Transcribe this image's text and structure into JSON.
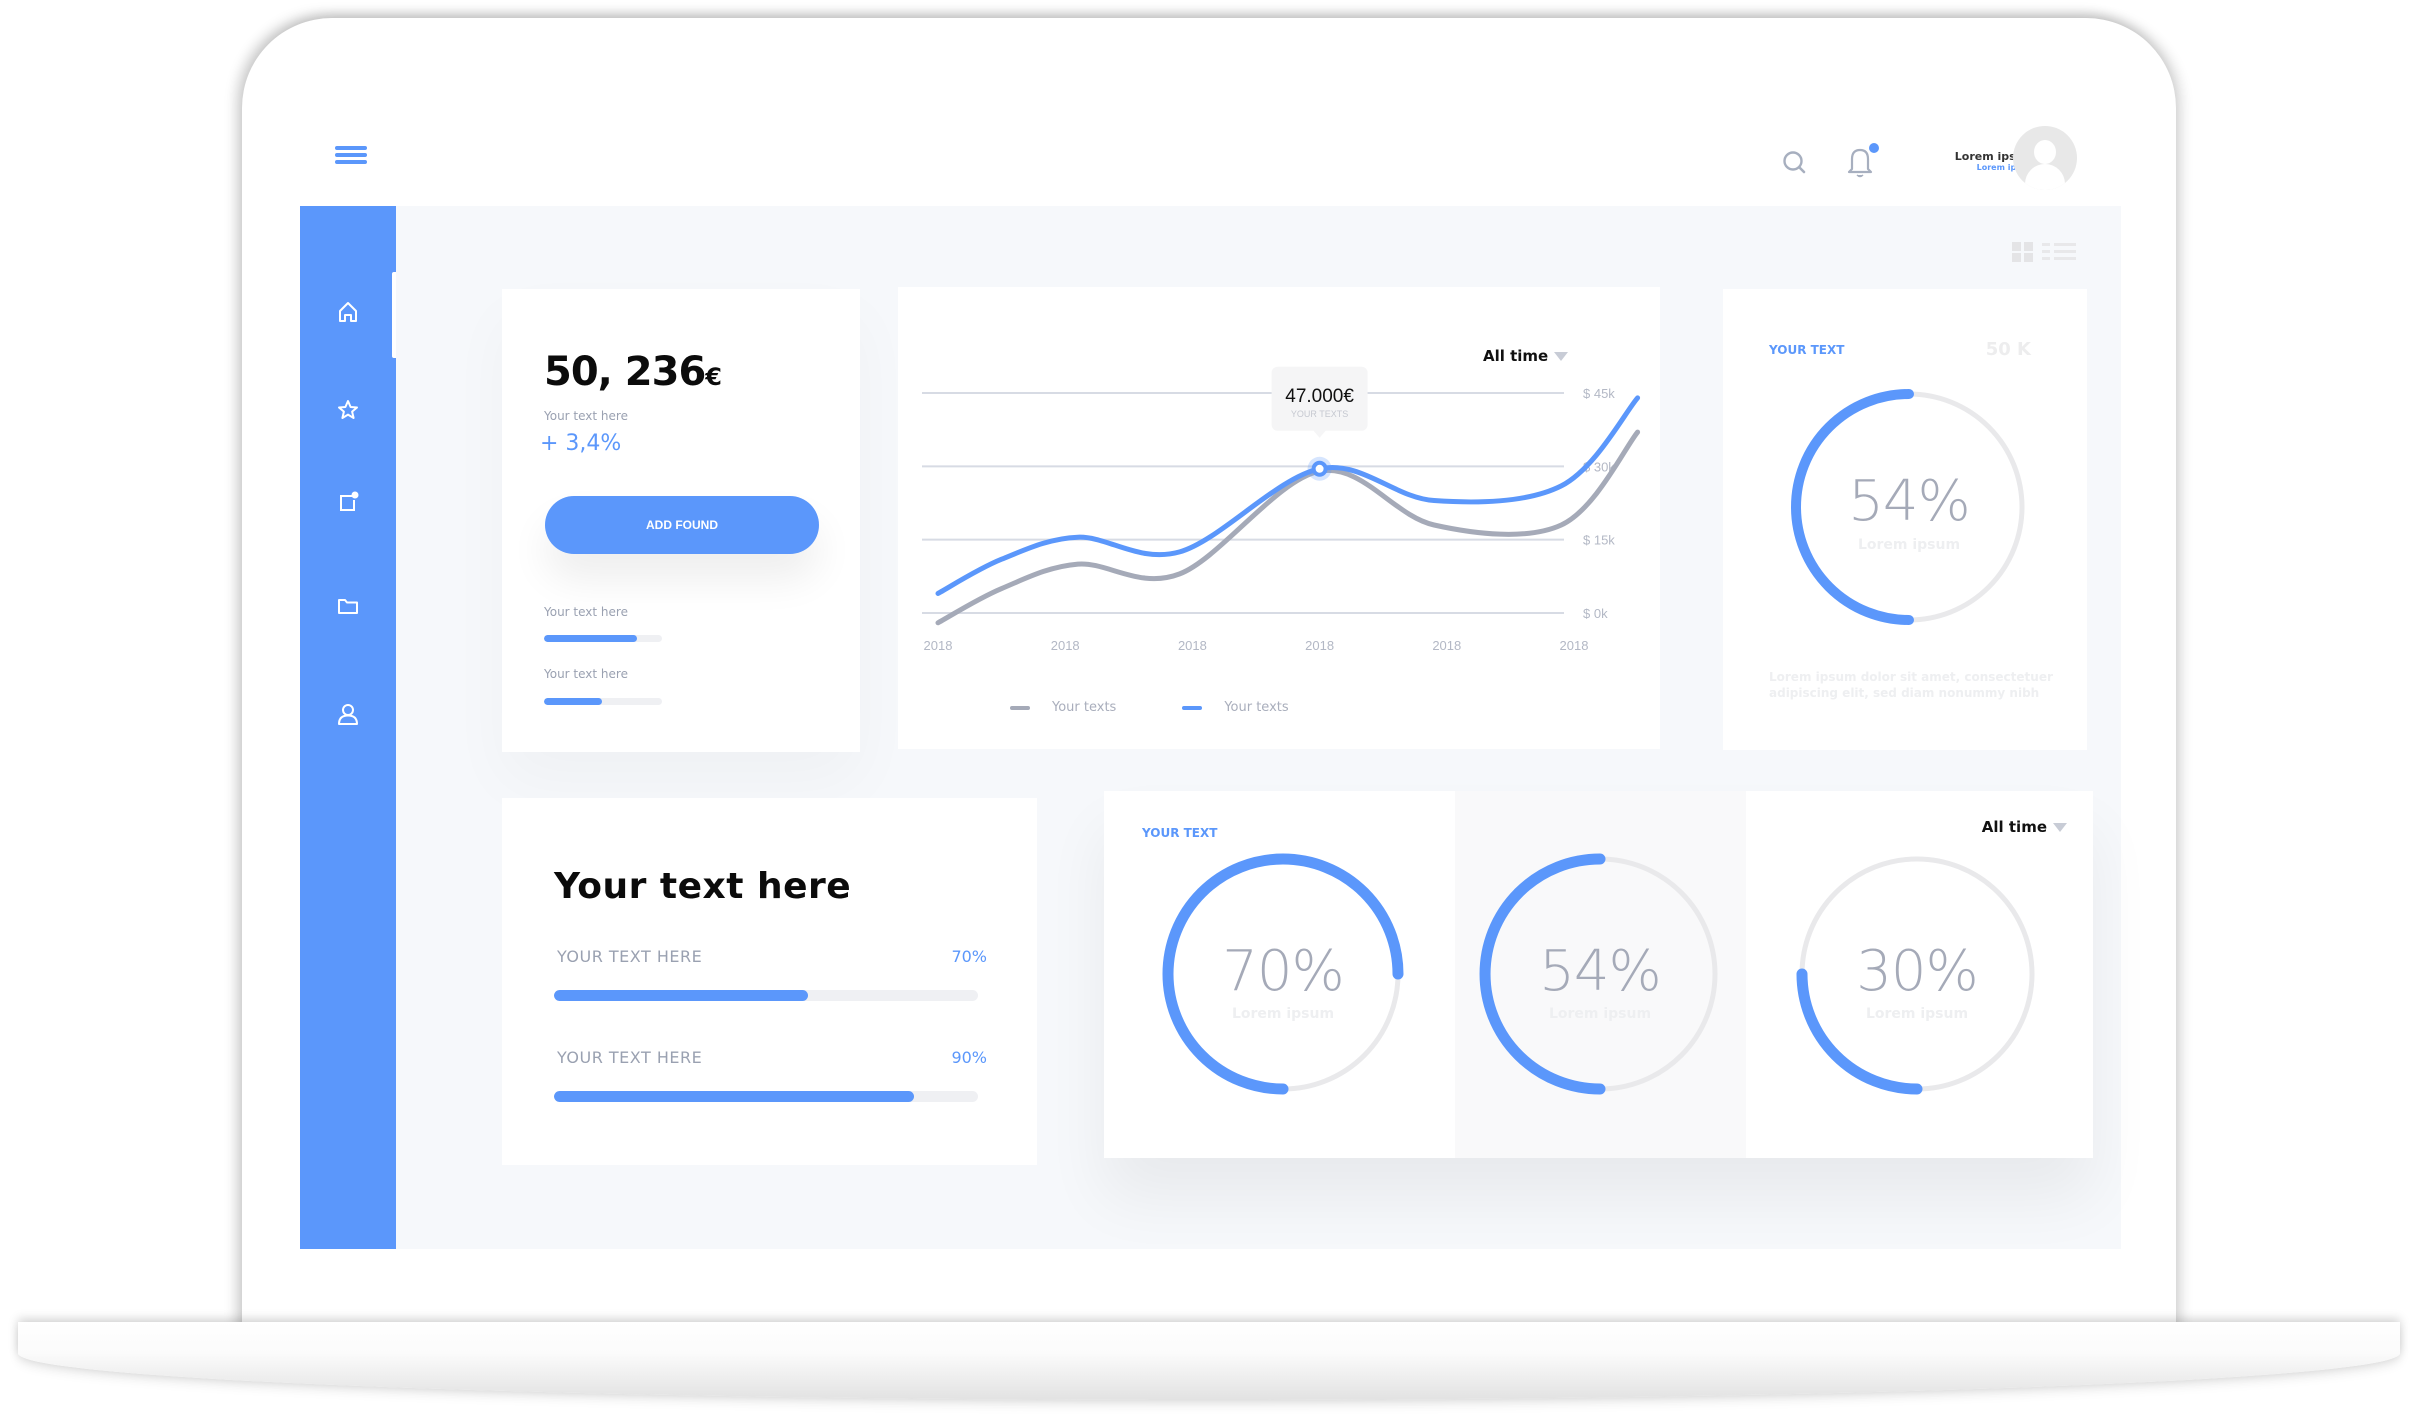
{
  "header": {
    "menu_icon": "hamburger-menu-icon",
    "search_icon": "search-icon",
    "notifications_icon": "bell-icon",
    "has_notification": true,
    "user": {
      "name": "Lorem ipsum",
      "subtitle": "Lorem ipsum",
      "avatar_icon": "user-avatar-icon"
    }
  },
  "sidebar": {
    "items": [
      {
        "id": "home",
        "icon": "home-icon",
        "active": true
      },
      {
        "id": "favorites",
        "icon": "star-icon",
        "active": false
      },
      {
        "id": "notes",
        "icon": "note-badge-icon",
        "active": false
      },
      {
        "id": "files",
        "icon": "folder-icon",
        "active": false
      },
      {
        "id": "profile",
        "icon": "user-icon",
        "active": false
      }
    ]
  },
  "view_toggle": {
    "grid_icon": "grid-view-icon",
    "list_icon": "list-view-icon"
  },
  "balance_card": {
    "amount": "50, 236",
    "currency": "€",
    "subtitle": "Your text here",
    "change": "+ 3,4%",
    "button_label": "ADD FOUND",
    "progress": [
      {
        "label": "Your text here",
        "fraction": 0.79
      },
      {
        "label": "Your text here",
        "fraction": 0.49
      }
    ]
  },
  "chart_card": {
    "period_filter": "All time",
    "tooltip": {
      "value": "47.000€",
      "label": "YOUR TEXTS"
    }
  },
  "chart_data": {
    "type": "line",
    "title": "",
    "xlabel": "",
    "ylabel": "",
    "categories": [
      "2018",
      "2018",
      "2018",
      "2018",
      "2018",
      "2018"
    ],
    "y_ticks": [
      "$ 0k",
      "$ 15k",
      "$ 30k",
      "$ 45k"
    ],
    "ylim": [
      0,
      45
    ],
    "grid": true,
    "legend": "bottom",
    "series": [
      {
        "name": "Your texts",
        "color": "#a5aab8",
        "x": [
          0,
          0.5,
          1.1,
          1.9,
          3.0,
          3.9,
          4.9,
          5.5
        ],
        "values": [
          -2,
          5,
          10,
          8,
          29,
          18,
          18,
          37
        ]
      },
      {
        "name": "Your texts",
        "color": "#5b97fb",
        "x": [
          0,
          0.5,
          1.1,
          1.9,
          3.0,
          3.9,
          4.9,
          5.5
        ],
        "values": [
          4,
          11,
          15.5,
          12.5,
          29.5,
          23,
          26,
          44
        ]
      }
    ],
    "highlight": {
      "series": 1,
      "x": 3.0,
      "value": 29.5
    }
  },
  "ring_card": {
    "tag": "YOUR TEXT",
    "total": "50 K",
    "percent_label": "54%",
    "fraction": 0.5,
    "caption": "Lorem ipsum",
    "description": "Lorem ipsum dolor sit amet, consectetuer adipiscing elit, sed diam nonummy nibh"
  },
  "skills_card": {
    "title": "Your text here",
    "rows": [
      {
        "label": "YOUR TEXT HERE",
        "value": "70%",
        "fraction": 0.6
      },
      {
        "label": "YOUR TEXT HERE",
        "value": "90%",
        "fraction": 0.85
      }
    ]
  },
  "rings_card": {
    "tag": "YOUR TEXT",
    "period_filter": "All time",
    "rings": [
      {
        "percent_label": "70%",
        "caption": "Lorem ipsum",
        "fraction": 0.75
      },
      {
        "percent_label": "54%",
        "caption": "Lorem ipsum",
        "fraction": 0.5
      },
      {
        "percent_label": "30%",
        "caption": "Lorem ipsum",
        "fraction": 0.25
      }
    ]
  },
  "colors": {
    "accent": "#5b97fb",
    "muted_text": "#9aa1b1",
    "track": "#e9e9eb",
    "content_bg": "#f6f8fb"
  }
}
